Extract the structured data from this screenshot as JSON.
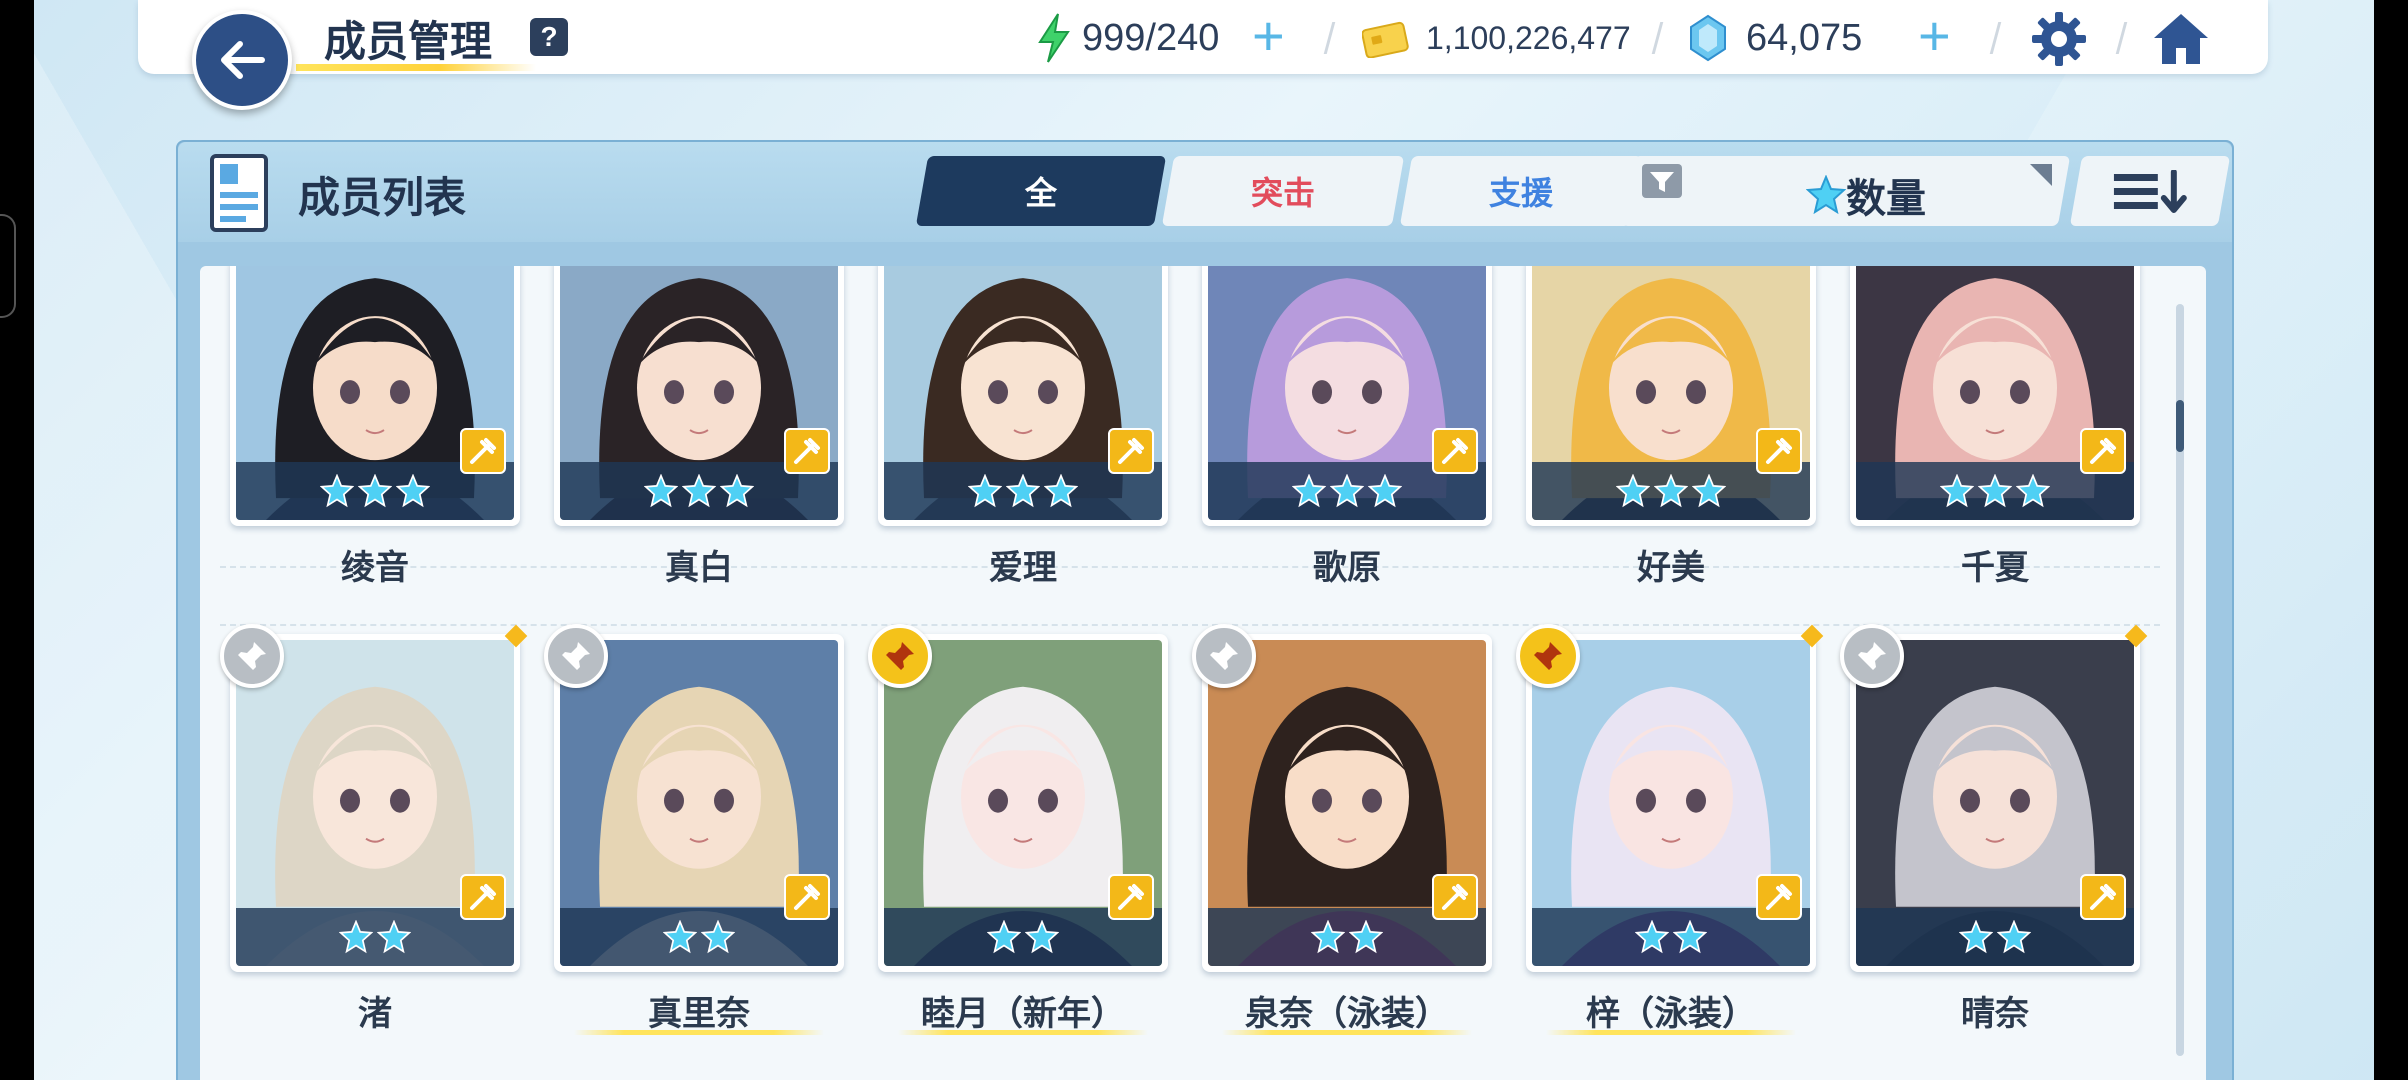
{
  "header": {
    "title": "成员管理",
    "help": "?",
    "ap": "999/240",
    "credits": "1,100,226,477",
    "gems": "64,075"
  },
  "panel": {
    "title": "成员列表",
    "tabs": [
      "全",
      "突击",
      "支援"
    ],
    "filter_label": "数量"
  },
  "members": [
    {
      "name": "绫音",
      "stars": 3,
      "pin": "",
      "new": false,
      "portrait": {
        "hair": "#1e1e24",
        "bg": "#9fc6e2",
        "skin": "#f6dcc9",
        "outfit": "#2b3550"
      }
    },
    {
      "name": "真白",
      "stars": 3,
      "pin": "",
      "new": false,
      "portrait": {
        "hair": "#2a2326",
        "bg": "#8aa9c6",
        "skin": "#f7dfd0",
        "outfit": "#231b22"
      }
    },
    {
      "name": "爱理",
      "stars": 3,
      "pin": "",
      "new": false,
      "portrait": {
        "hair": "#3a2a22",
        "bg": "#a8cbe0",
        "skin": "#f8e3d2",
        "outfit": "#3a4556"
      }
    },
    {
      "name": "歌原",
      "stars": 3,
      "pin": "",
      "new": false,
      "portrait": {
        "hair": "#b79bdc",
        "bg": "#6f86b8",
        "skin": "#f4dde1",
        "outfit": "#2d3a58"
      }
    },
    {
      "name": "好美",
      "stars": 3,
      "pin": "",
      "new": false,
      "portrait": {
        "hair": "#f0b948",
        "bg": "#e6d5a6",
        "skin": "#f8dfcd",
        "outfit": "#2a2426"
      }
    },
    {
      "name": "千夏",
      "stars": 3,
      "pin": "",
      "new": false,
      "portrait": {
        "hair": "#e9b5b2",
        "bg": "#3c3644",
        "skin": "#f7e0d6",
        "outfit": "#2b2a35"
      }
    },
    {
      "name": "渚",
      "stars": 2,
      "pin": "grey",
      "new": true,
      "portrait": {
        "hair": "#ddd6c6",
        "bg": "#cfe3ea",
        "skin": "#f8e6da",
        "outfit": "#f2f2ef"
      }
    },
    {
      "name": "真里奈",
      "stars": 2,
      "pin": "grey",
      "new": false,
      "portrait": {
        "hair": "#e6d5b4",
        "bg": "#5e7fa8",
        "skin": "#f7e2d2",
        "outfit": "#e8e8e6"
      }
    },
    {
      "name": "睦月（新年）",
      "stars": 2,
      "pin": "gold",
      "new": false,
      "portrait": {
        "hair": "#f0eef0",
        "bg": "#7fa07a",
        "skin": "#f9e6e4",
        "outfit": "#2a2a3c"
      }
    },
    {
      "name": "泉奈（泳装）",
      "stars": 2,
      "pin": "grey",
      "new": false,
      "portrait": {
        "hair": "#2e221e",
        "bg": "#c98b55",
        "skin": "#f8ddc8",
        "outfit": "#d43560"
      }
    },
    {
      "name": "梓（泳装）",
      "stars": 2,
      "pin": "gold",
      "new": true,
      "portrait": {
        "hair": "#e9e4f3",
        "bg": "#a8cfe8",
        "skin": "#f9e4e2",
        "outfit": "#7a4cae"
      }
    },
    {
      "name": "晴奈",
      "stars": 2,
      "pin": "grey",
      "new": true,
      "portrait": {
        "hair": "#c4c4cc",
        "bg": "#3a3e4c",
        "skin": "#f6e1d8",
        "outfit": "#1e2230"
      }
    }
  ],
  "colors": {
    "accent_dark": "#1d3a5e",
    "strike": "#e24c5c",
    "support": "#3f82e0",
    "role_badge": "#f3b818",
    "star": "#4fd0f4"
  },
  "icons": {
    "back": "arrow-left-icon",
    "ap": "lightning-icon",
    "credits": "credit-card-icon",
    "gems": "crystal-icon",
    "settings": "gear-icon",
    "home": "home-icon",
    "list": "member-list-icon",
    "filter": "filter-funnel-icon",
    "sort": "sort-descending-icon",
    "pin": "pin-icon",
    "role": "striker-role-icon"
  }
}
